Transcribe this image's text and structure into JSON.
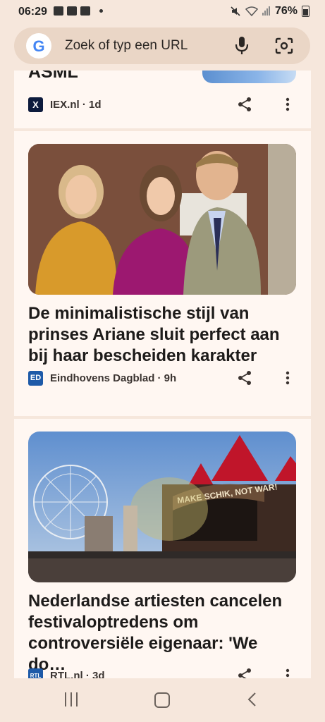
{
  "status_bar": {
    "time": "06:29",
    "battery": "76%"
  },
  "url_bar": {
    "placeholder": "Zoek of typ een URL",
    "logo_letter": "G"
  },
  "cards": [
    {
      "title_partial": "ASML",
      "source": "IEX.nl · 1d",
      "logo_text": "X",
      "logo_color": "#0d1b3d"
    },
    {
      "title": "De minimalistische stijl van prinses Ariane sluit perfect aan bij haar bescheiden karakter",
      "source": "Eindhovens Dagblad · 9h",
      "logo_text": "ED",
      "logo_color": "#1e5aa8"
    },
    {
      "title": "Nederlandse artiesten cancelen festivaloptredens om controversiële eigenaar: 'We do…",
      "banner_text": "MAKE SCHIK, NOT WAR!",
      "source": "RTL.nl · 3d",
      "logo_text": "RTL",
      "logo_color": "#1e5aa8"
    }
  ],
  "colors": {
    "background": "#f6e7dc",
    "card": "#fff7f2",
    "url_bar": "#ead6c6"
  }
}
